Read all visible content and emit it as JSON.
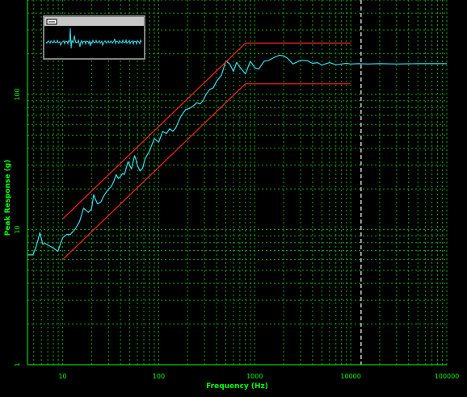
{
  "chart_data": {
    "type": "line",
    "xlabel": "Frequency (Hz)",
    "ylabel": "Peak Response (g)",
    "x_scale": "log",
    "y_scale": "log",
    "xlim": [
      4.3,
      100000
    ],
    "ylim": [
      1,
      500
    ],
    "grid": true,
    "x_ticks": [
      10,
      100,
      1000,
      10000,
      100000
    ],
    "x_tick_labels": [
      "10",
      "100",
      "1000",
      "10000",
      "100000"
    ],
    "y_ticks": [
      1,
      10,
      100
    ],
    "y_tick_labels": [
      "1",
      "10",
      "100"
    ],
    "marker_x": 12800,
    "colors": {
      "background": "#000000",
      "axis": "#00ff00",
      "grid": "#00aa00",
      "response": "#33ddee",
      "tolerance": "#ff2222",
      "marker": "#ffffff",
      "inset_border": "#aaaaaa",
      "inset_bar": "#c8c8c8"
    },
    "series": [
      {
        "x": [
          4.3,
          4.9,
          5.3,
          5.8,
          6.2,
          6.6,
          7.2,
          8.0,
          8.9,
          9.4,
          10,
          11,
          12,
          13.5,
          15,
          16.5,
          17.5,
          18.5,
          20,
          21,
          23,
          25,
          26,
          27.5,
          30,
          32,
          34,
          36,
          38,
          40,
          42,
          44,
          48,
          52,
          56,
          58,
          60,
          64,
          68,
          72,
          76,
          80,
          90,
          100,
          110,
          120,
          130,
          140,
          150,
          170,
          190,
          210,
          230,
          250,
          270,
          290,
          310,
          340,
          370,
          400,
          450,
          500,
          550,
          600,
          650,
          700,
          800,
          900,
          1000,
          1100,
          1250,
          1400,
          1600,
          1800,
          2000,
          2200,
          2500,
          3000,
          3500,
          4000,
          4500,
          5000,
          6000,
          7000,
          8000,
          9000,
          10000,
          12000,
          15000,
          20000,
          30000,
          50000,
          80000,
          100000
        ],
        "y": [
          6.5,
          6.5,
          7.5,
          9.5,
          7.8,
          7.9,
          7.6,
          7.3,
          6.9,
          7.7,
          8.7,
          9.2,
          9.2,
          10.1,
          11.5,
          14.4,
          13.9,
          13.4,
          14.2,
          18.1,
          15.5,
          16.0,
          17.0,
          18.3,
          19.9,
          20.8,
          22.6,
          25.5,
          23.9,
          24.7,
          26.0,
          25.6,
          31.9,
          28.1,
          35.2,
          32.9,
          29.7,
          27.2,
          28.4,
          33.3,
          35.8,
          37.9,
          47.4,
          44.3,
          53.4,
          51.4,
          55.7,
          53.4,
          56.3,
          68.9,
          77.1,
          79.0,
          82.6,
          86.9,
          85.0,
          90.1,
          99.8,
          109,
          112,
          125,
          139,
          177,
          168,
          148,
          173,
          159,
          142,
          176,
          158,
          154,
          176,
          179,
          188,
          195,
          193,
          185,
          168,
          179,
          178,
          170,
          172,
          165,
          172,
          166,
          168,
          170,
          168,
          169,
          168,
          169,
          168,
          169,
          169,
          169
        ]
      },
      {
        "x": [
          10,
          800,
          10000
        ],
        "y": [
          12,
          240,
          240
        ]
      },
      {
        "x": [
          10,
          800,
          10000
        ],
        "y": [
          6,
          120,
          120
        ]
      }
    ]
  }
}
